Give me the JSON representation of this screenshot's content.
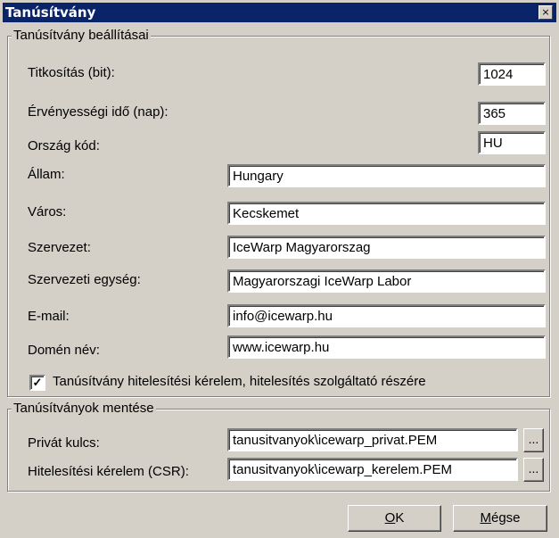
{
  "window": {
    "title": "Tanúsítvány",
    "close_glyph": "×"
  },
  "settings_group": {
    "title": "Tanúsítvány beállításai",
    "fields": [
      {
        "label": "Titkosítás (bit):",
        "value": "1024"
      },
      {
        "label": "Érvényességi idő (nap):",
        "value": "365"
      },
      {
        "label": "Ország kód:",
        "value": "HU"
      },
      {
        "label": "Állam:",
        "value": "Hungary"
      },
      {
        "label": "Város:",
        "value": "Kecskemet"
      },
      {
        "label": "Szervezet:",
        "value": "IceWarp Magyarorszag"
      },
      {
        "label": "Szervezeti egység:",
        "value": "Magyarorszagi IceWarp Labor"
      },
      {
        "label": "E-mail:",
        "value": "info@icewarp.hu"
      },
      {
        "label": "Domén név:",
        "value": "www.icewarp.hu"
      }
    ],
    "csr_checkbox": {
      "label": "Tanúsítvány hitelesítési kérelem, hitelesítés szolgáltató részére",
      "checked": true,
      "check_glyph": "✓"
    }
  },
  "save_group": {
    "title": "Tanúsítványok mentése",
    "private_key": {
      "label": "Privát kulcs:",
      "value": "tanusitvanyok\\icewarp_privat.PEM",
      "browse": "..."
    },
    "csr": {
      "label": "Hitelesítési kérelem (CSR):",
      "value": "tanusitvanyok\\icewarp_kerelem.PEM",
      "browse": "..."
    }
  },
  "buttons": {
    "ok_mnemonic": "O",
    "ok_rest": "K",
    "cancel_mnemonic": "M",
    "cancel_rest": "égse"
  }
}
